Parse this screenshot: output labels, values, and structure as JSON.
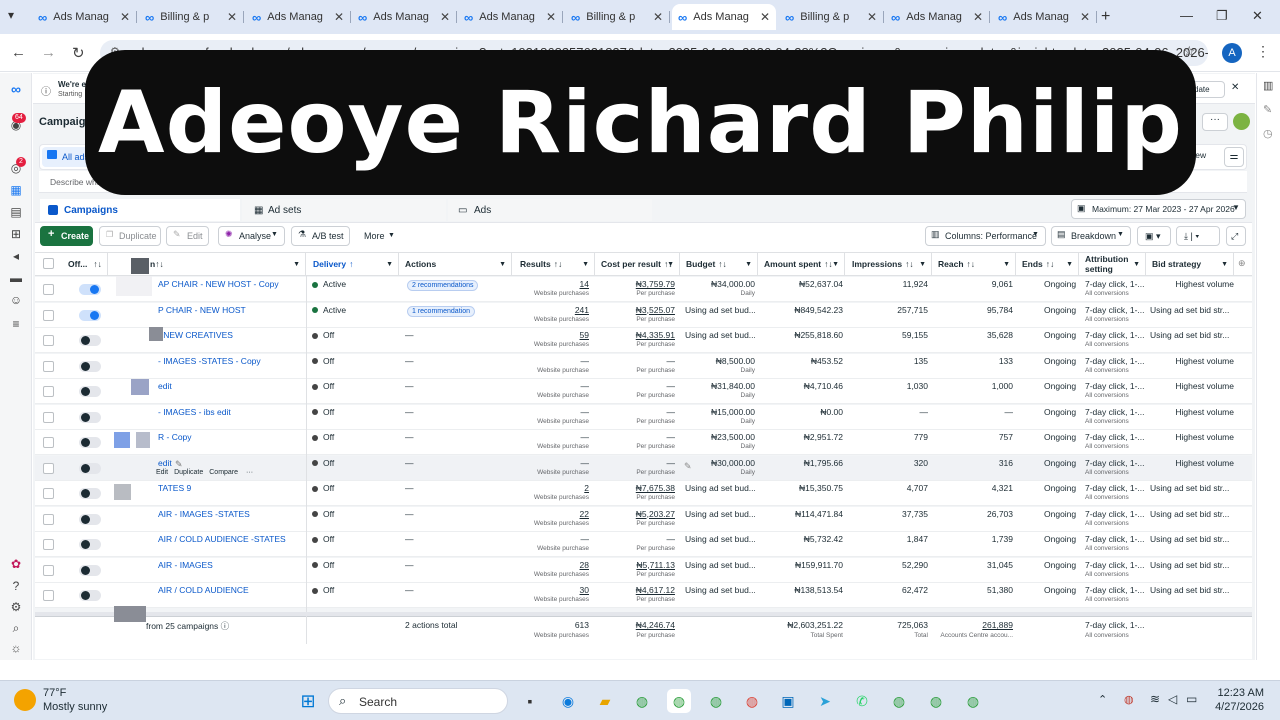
{
  "browser": {
    "tabs": [
      {
        "title": "Ads Manag"
      },
      {
        "title": "Billing & p"
      },
      {
        "title": "Ads Manag"
      },
      {
        "title": "Ads Manag"
      },
      {
        "title": "Ads Manag"
      },
      {
        "title": "Billing & p"
      },
      {
        "title": "Ads Manag",
        "active": true
      },
      {
        "title": "Billing & p"
      },
      {
        "title": "Ads Manag"
      },
      {
        "title": "Ads Manag"
      }
    ],
    "url": "adsmanager.facebook.com/adsmanager/manage/campaigns?act=1931868357621827&date=2025-04-06_2026-04-28%2Cmaximum&comparison_date=&insights_date=2025-04-06_2026-04-28",
    "profile_initial": "A"
  },
  "rail": {
    "notif_badge": "64",
    "alert_badge": "2"
  },
  "notice": {
    "line1": "We're ev",
    "line2": "Starting",
    "update_label": "date"
  },
  "page": {
    "title": "Campaigns",
    "all_ads": "All ads",
    "search_placeholder": "Describe what",
    "view_label": "a view"
  },
  "banner": {
    "text": "Adeoye Richard Philip"
  },
  "level_tabs": {
    "campaigns": "Campaigns",
    "adsets": "Ad sets",
    "ads": "Ads"
  },
  "date_range": "Maximum: 27 Mar 2023 - 27 Apr 2026",
  "toolbar": {
    "create": "Create",
    "duplicate": "Duplicate",
    "edit": "Edit",
    "analyse": "Analyse",
    "abtest": "A/B test",
    "more": "More",
    "columns": "Columns: Performance",
    "breakdown": "Breakdown"
  },
  "table": {
    "headers": {
      "offon": "Off...",
      "name": "n",
      "delivery": "Delivery",
      "actions": "Actions",
      "results": "Results",
      "cpr": "Cost per result",
      "budget": "Budget",
      "spent": "Amount spent",
      "impressions": "Impressions",
      "reach": "Reach",
      "ends": "Ends",
      "attribution1": "Attribution",
      "attribution2": "setting",
      "bid": "Bid strategy"
    },
    "rows": [
      {
        "on": true,
        "name": "AP CHAIR - NEW HOST - Copy",
        "delivery": "Active",
        "dot": "on",
        "actions": "2 recommendations",
        "chip": true,
        "results": "14",
        "results_sub": "Website purchases",
        "cpr": "₦3,759.79",
        "cpr_sub": "Per purchase",
        "budget": "₦34,000.00",
        "budget_sub": "Daily",
        "spent": "₦52,637.04",
        "impressions": "11,924",
        "reach": "9,061",
        "ends": "Ongoing",
        "attr": "7-day click, 1-...",
        "attr_sub": "All conversions",
        "bid": "Highest volume"
      },
      {
        "on": true,
        "name": "P CHAIR - NEW HOST",
        "delivery": "Active",
        "dot": "on",
        "actions": "1 recommendation",
        "chip": true,
        "results": "241",
        "results_sub": "Website purchases",
        "cpr": "₦3,525.07",
        "cpr_sub": "Per purchase",
        "budget": "Using ad set bud...",
        "budget_sub": "",
        "spent": "₦849,542.23",
        "impressions": "257,715",
        "reach": "95,784",
        "ends": "Ongoing",
        "attr": "7-day click, 1-...",
        "attr_sub": "All conversions",
        "bid": "Using ad set bid str..."
      },
      {
        "on": false,
        "name": "- NEW CREATIVES",
        "delivery": "Off",
        "dot": "off",
        "actions": "—",
        "results": "59",
        "results_sub": "Website purchases",
        "cpr": "₦4,335.91",
        "cpr_sub": "Per purchase",
        "budget": "Using ad set bud...",
        "budget_sub": "",
        "spent": "₦255,818.60",
        "impressions": "59,155",
        "reach": "35,628",
        "ends": "Ongoing",
        "attr": "7-day click, 1-...",
        "attr_sub": "All conversions",
        "bid": "Using ad set bid str..."
      },
      {
        "on": false,
        "name": "- IMAGES -STATES - Copy",
        "delivery": "Off",
        "dot": "off",
        "actions": "—",
        "results": "—",
        "results_sub": "Website purchase",
        "cpr": "—",
        "cpr_sub": "Per purchase",
        "budget": "₦8,500.00",
        "budget_sub": "Daily",
        "spent": "₦453.52",
        "impressions": "135",
        "reach": "133",
        "ends": "Ongoing",
        "attr": "7-day click, 1-...",
        "attr_sub": "All conversions",
        "bid": "Highest volume"
      },
      {
        "on": false,
        "name": "edit",
        "delivery": "Off",
        "dot": "off",
        "actions": "—",
        "results": "—",
        "results_sub": "Website purchase",
        "cpr": "—",
        "cpr_sub": "Per purchase",
        "budget": "₦31,840.00",
        "budget_sub": "Daily",
        "spent": "₦4,710.46",
        "impressions": "1,030",
        "reach": "1,000",
        "ends": "Ongoing",
        "attr": "7-day click, 1-...",
        "attr_sub": "All conversions",
        "bid": "Highest volume"
      },
      {
        "on": false,
        "name": "- IMAGES - ibs edit",
        "delivery": "Off",
        "dot": "off",
        "actions": "—",
        "results": "—",
        "results_sub": "Website purchase",
        "cpr": "—",
        "cpr_sub": "Per purchase",
        "budget": "₦15,000.00",
        "budget_sub": "Daily",
        "spent": "₦0.00",
        "impressions": "—",
        "reach": "—",
        "ends": "Ongoing",
        "attr": "7-day click, 1-...",
        "attr_sub": "All conversions",
        "bid": "Highest volume"
      },
      {
        "on": false,
        "name": "R - Copy",
        "delivery": "Off",
        "dot": "off",
        "actions": "—",
        "results": "—",
        "results_sub": "Website purchase",
        "cpr": "—",
        "cpr_sub": "Per purchase",
        "budget": "₦23,500.00",
        "budget_sub": "Daily",
        "spent": "₦2,951.72",
        "impressions": "779",
        "reach": "757",
        "ends": "Ongoing",
        "attr": "7-day click, 1-...",
        "attr_sub": "All conversions",
        "bid": "Highest volume"
      },
      {
        "on": false,
        "name": "edit",
        "hover": true,
        "delivery": "Off",
        "dot": "off",
        "actions": "—",
        "results": "—",
        "results_sub": "Website purchase",
        "cpr": "—",
        "cpr_sub": "Per purchase",
        "budget": "₦30,000.00",
        "budget_sub": "Daily",
        "spent": "₦1,795.66",
        "impressions": "320",
        "reach": "316",
        "ends": "Ongoing",
        "attr": "7-day click, 1-...",
        "attr_sub": "All conversions",
        "bid": "Highest volume"
      },
      {
        "on": false,
        "name": "TATES 9",
        "delivery": "Off",
        "dot": "off",
        "actions": "—",
        "results": "2",
        "results_sub": "Website purchases",
        "cpr": "₦7,675.38",
        "cpr_sub": "Per purchase",
        "budget": "Using ad set bud...",
        "budget_sub": "",
        "spent": "₦15,350.75",
        "impressions": "4,707",
        "reach": "4,321",
        "ends": "Ongoing",
        "attr": "7-day click, 1-...",
        "attr_sub": "All conversions",
        "bid": "Using ad set bid str..."
      },
      {
        "on": false,
        "name": "AIR - IMAGES -STATES",
        "delivery": "Off",
        "dot": "off",
        "actions": "—",
        "results": "22",
        "results_sub": "Website purchases",
        "cpr": "₦5,203.27",
        "cpr_sub": "Per purchase",
        "budget": "Using ad set bud...",
        "budget_sub": "",
        "spent": "₦114,471.84",
        "impressions": "37,735",
        "reach": "26,703",
        "ends": "Ongoing",
        "attr": "7-day click, 1-...",
        "attr_sub": "All conversions",
        "bid": "Using ad set bid str..."
      },
      {
        "on": false,
        "name": "AIR / COLD AUDIENCE -STATES",
        "delivery": "Off",
        "dot": "off",
        "actions": "—",
        "results": "—",
        "results_sub": "Website purchase",
        "cpr": "—",
        "cpr_sub": "Per purchase",
        "budget": "Using ad set bud...",
        "budget_sub": "",
        "spent": "₦5,732.42",
        "impressions": "1,847",
        "reach": "1,739",
        "ends": "Ongoing",
        "attr": "7-day click, 1-...",
        "attr_sub": "All conversions",
        "bid": "Using ad set bid str..."
      },
      {
        "on": false,
        "name": "AIR - IMAGES",
        "delivery": "Off",
        "dot": "off",
        "actions": "—",
        "results": "28",
        "results_sub": "Website purchases",
        "cpr": "₦5,711.13",
        "cpr_sub": "Per purchase",
        "budget": "Using ad set bud...",
        "budget_sub": "",
        "spent": "₦159,911.70",
        "impressions": "52,290",
        "reach": "31,045",
        "ends": "Ongoing",
        "attr": "7-day click, 1-...",
        "attr_sub": "All conversions",
        "bid": "Using ad set bid str..."
      },
      {
        "on": false,
        "name": "AIR / COLD AUDIENCE",
        "delivery": "Off",
        "dot": "off",
        "actions": "—",
        "results": "30",
        "results_sub": "Website purchases",
        "cpr": "₦4,617.12",
        "cpr_sub": "Per purchase",
        "budget": "Using ad set bud...",
        "budget_sub": "",
        "spent": "₦138,513.54",
        "impressions": "62,472",
        "reach": "51,380",
        "ends": "Ongoing",
        "attr": "7-day click, 1-...",
        "attr_sub": "All conversions",
        "bid": "Using ad set bid str..."
      }
    ],
    "hover_actions": {
      "edit": "Edit",
      "duplicate": "Duplicate",
      "compare": "Compare"
    },
    "totals": {
      "label": "from 25 campaigns",
      "actions": "2 actions total",
      "results": "613",
      "results_sub": "Website purchases",
      "cpr": "₦4,246.74",
      "cpr_sub": "Per purchase",
      "spent": "₦2,603,251.22",
      "spent_sub": "Total Spent",
      "impressions": "725,063",
      "impressions_sub": "Total",
      "reach": "261,889",
      "reach_sub": "Accounts Centre accou...",
      "attr": "7-day click, 1-...",
      "attr_sub": "All conversions"
    }
  },
  "taskbar": {
    "temp": "77°F",
    "weather": "Mostly sunny",
    "search": "Search",
    "time": "12:23 AM",
    "date": "4/27/2026"
  }
}
